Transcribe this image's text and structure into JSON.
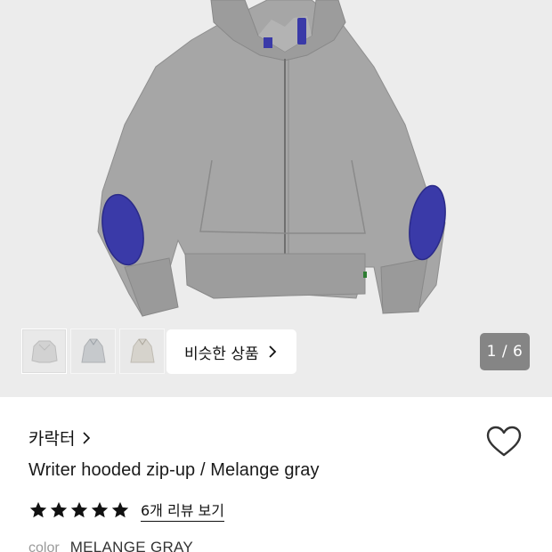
{
  "gallery": {
    "thumbnails": [
      {
        "icon": "hoodie-lightgray-thumb"
      },
      {
        "icon": "hoodie-gray-thumb"
      },
      {
        "icon": "hoodie-beige-thumb"
      }
    ],
    "similar_label": "비슷한 상품",
    "counter": "1 / 6",
    "colors": {
      "body": "#a4a4a4",
      "patch": "#3a3aa8",
      "background": "#ececec"
    }
  },
  "product": {
    "brand": "카락터",
    "title": "Writer hooded zip-up / Melange gray",
    "rating_stars": 5,
    "review_link": "6개 리뷰 보기",
    "color_label": "color",
    "color_value": "MELANGE GRAY"
  }
}
